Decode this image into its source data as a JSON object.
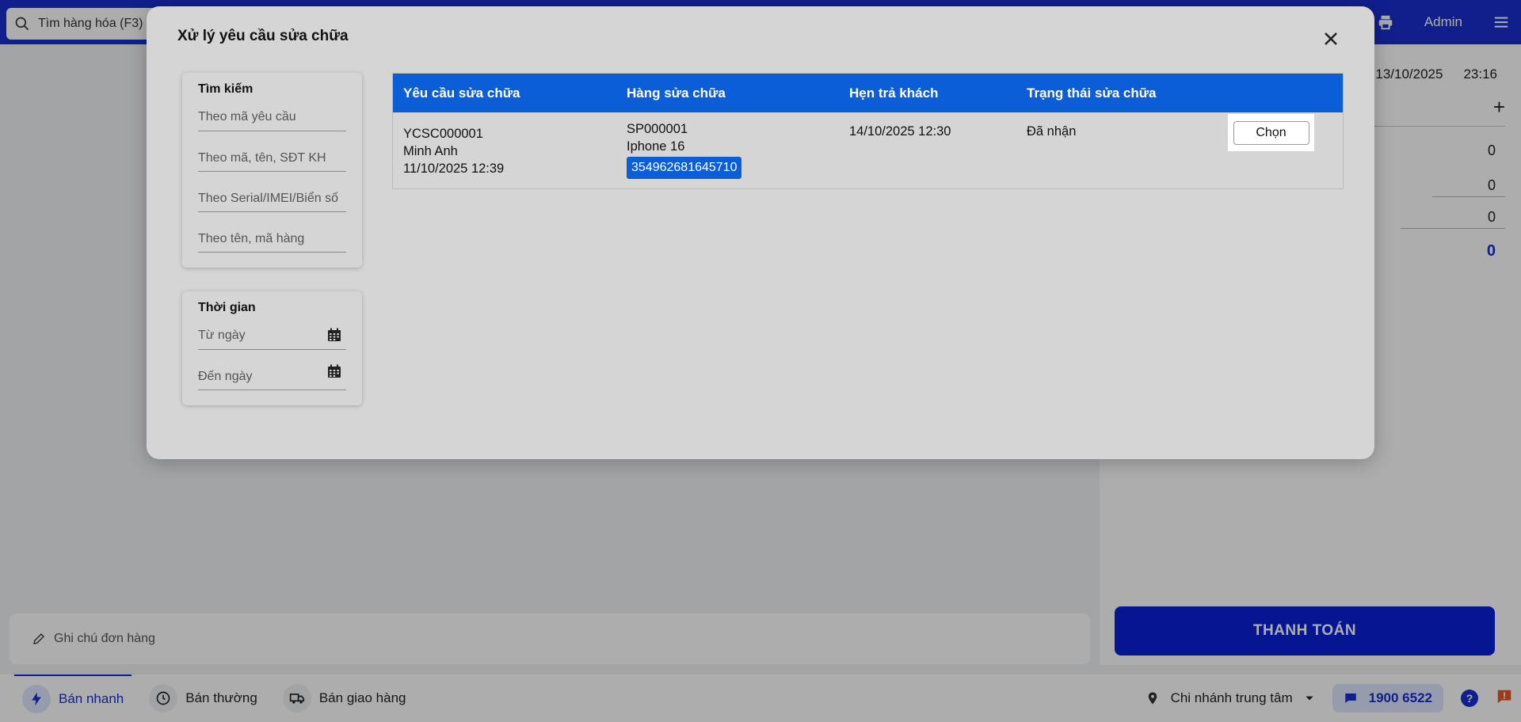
{
  "topbar": {
    "search_placeholder": "Tìm hàng hóa (F3)",
    "user": "Admin"
  },
  "right_panel": {
    "date": "13/10/2025",
    "time": "23:16",
    "values": [
      "0",
      "0",
      "0",
      "0"
    ],
    "pay_label": "THANH TOÁN"
  },
  "note": {
    "placeholder": "Ghi chú đơn hàng"
  },
  "bottombar": {
    "tabs": [
      {
        "label": "Bán nhanh"
      },
      {
        "label": "Bán thường"
      },
      {
        "label": "Bán giao hàng"
      }
    ],
    "branch": "Chi nhánh trung tâm",
    "hotline": "1900 6522"
  },
  "modal": {
    "title": "Xử lý yêu cầu sửa chữa",
    "search_card": {
      "title": "Tìm kiếm",
      "placeholders": [
        "Theo mã yêu cầu",
        "Theo mã, tên, SĐT KH",
        "Theo Serial/IMEI/Biển số",
        "Theo tên, mã hàng"
      ]
    },
    "time_card": {
      "title": "Thời gian",
      "from_placeholder": "Từ ngày",
      "to_placeholder": "Đến ngày"
    },
    "table": {
      "headers": [
        "Yêu cầu sửa chữa",
        "Hàng sửa chữa",
        "Hẹn trả khách",
        "Trạng thái sửa chữa"
      ],
      "rows": [
        {
          "request_code": "YCSC000001",
          "customer": "Minh Anh",
          "created": "11/10/2025 12:39",
          "product_code": "SP000001",
          "product_name": "Iphone 16",
          "imei": "354962681645710",
          "due": "14/10/2025 12:30",
          "status": "Đã nhận",
          "action": "Chọn"
        }
      ]
    }
  },
  "colors": {
    "brand": "#1a2fd0",
    "table_header": "#0b5ed7",
    "modal_bg": "#d5d5d5"
  }
}
